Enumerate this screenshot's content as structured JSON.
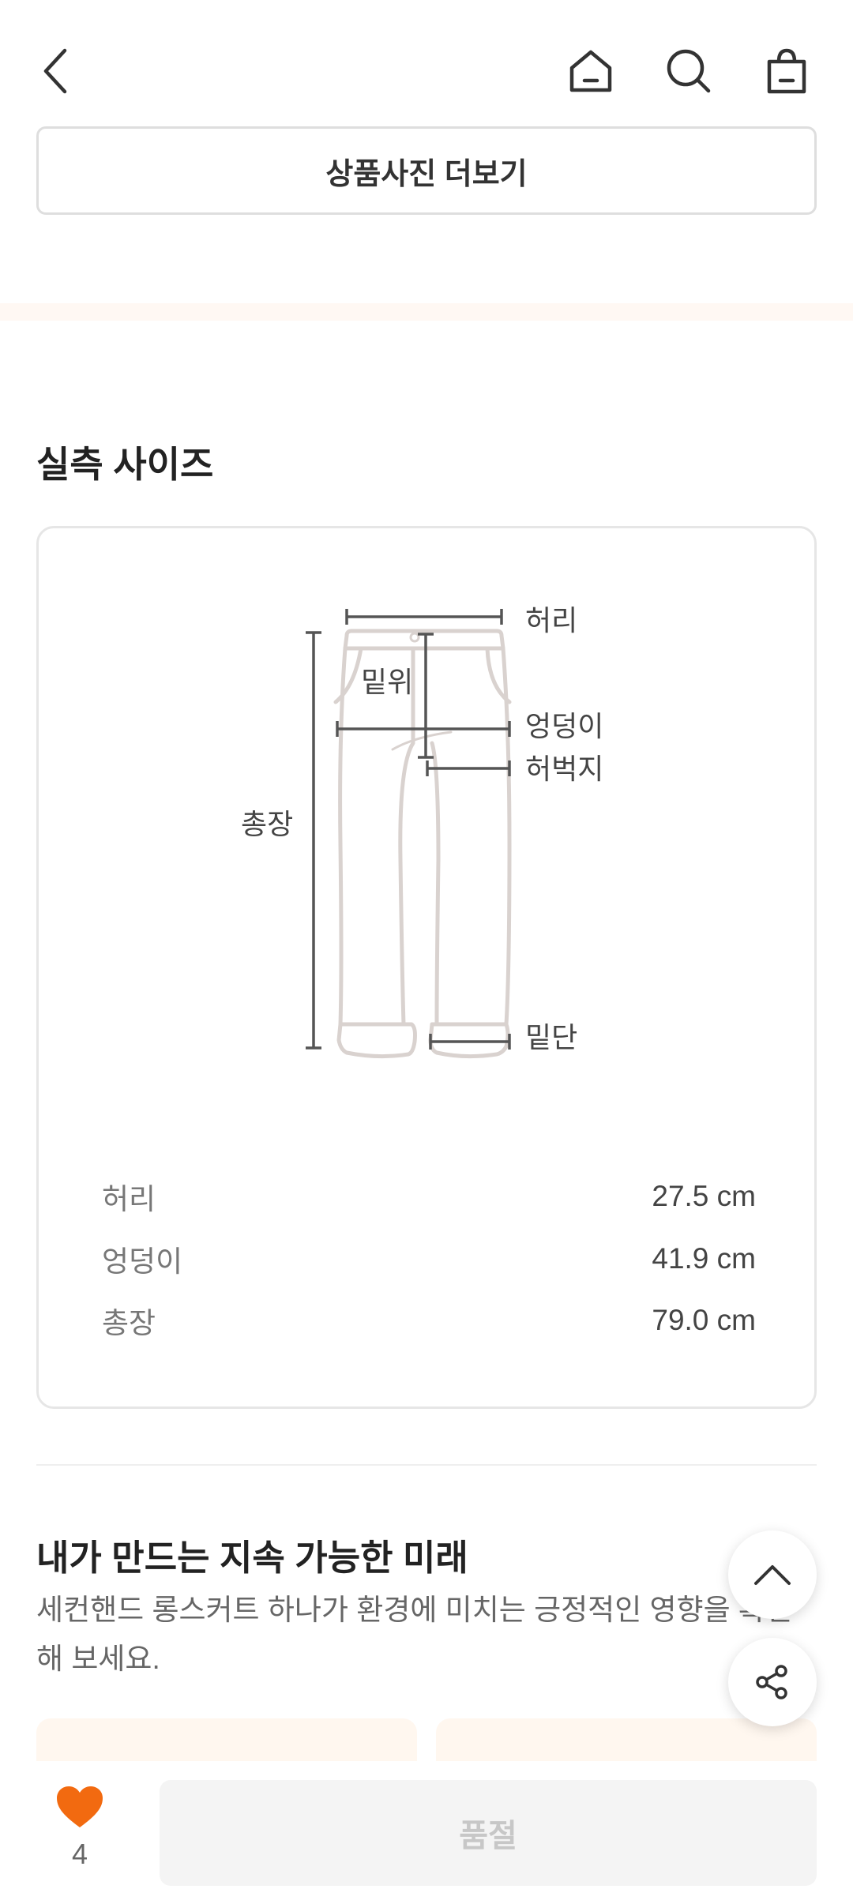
{
  "topbar": {
    "icons": [
      "back-arrow-icon",
      "home-icon",
      "search-icon",
      "shopping-bag-icon"
    ]
  },
  "more_photos_label": "상품사진 더보기",
  "size_section": {
    "title": "실측 사이즈",
    "diagram_labels": {
      "waist": "허리",
      "rise": "밑위",
      "hip": "엉덩이",
      "thigh": "허벅지",
      "length": "총장",
      "hem": "밑단"
    },
    "rows": [
      {
        "label": "허리",
        "value": "27.5 cm"
      },
      {
        "label": "엉덩이",
        "value": "41.9 cm"
      },
      {
        "label": "총장",
        "value": "79.0 cm"
      }
    ]
  },
  "sustain": {
    "title": "내가 만드는 지속 가능한 미래",
    "desc": "세컨핸드 롱스커트 하나가 환경에 미치는 긍정적인 영향을 확인해 보세요."
  },
  "bottom": {
    "like_count": "4",
    "soldout_label": "품절",
    "heart_color": "#f26a10"
  },
  "fabs": [
    "scroll-to-top-icon",
    "share-icon"
  ]
}
